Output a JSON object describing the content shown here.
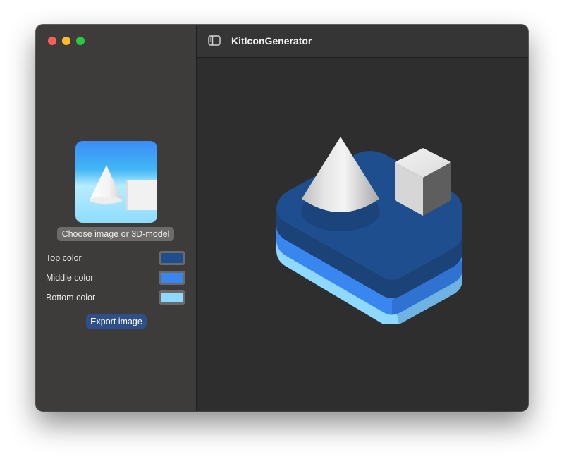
{
  "window": {
    "title": "KitIconGenerator",
    "traffic_lights": [
      "close",
      "minimize",
      "zoom"
    ]
  },
  "sidebar": {
    "choose_button": "Choose image or 3D-model",
    "colors": [
      {
        "label": "Top color",
        "value": "#1f4e8f"
      },
      {
        "label": "Middle color",
        "value": "#3a86f0"
      },
      {
        "label": "Bottom color",
        "value": "#8fd8ff"
      }
    ],
    "export_button": "Export image"
  },
  "toolbar": {
    "toggle_icon": "sidebar-toggle-icon"
  },
  "canvas": {
    "preview_icon": "3d-layered-icon"
  }
}
